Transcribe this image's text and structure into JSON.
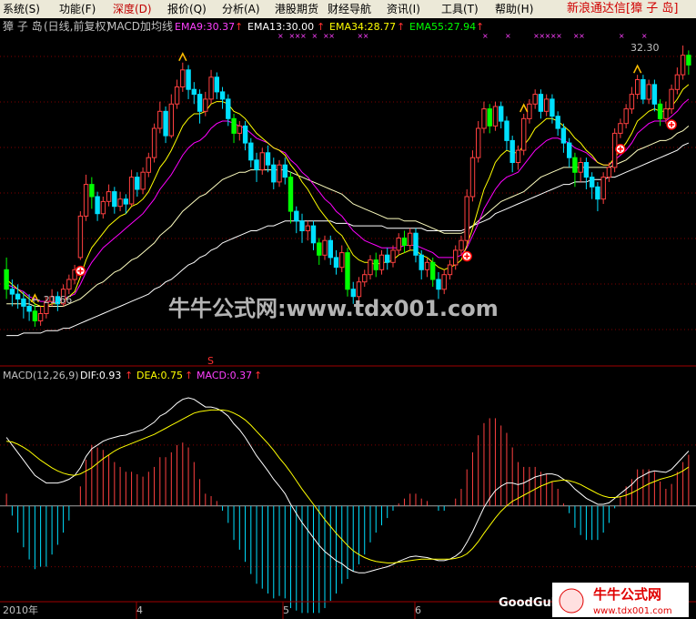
{
  "menu": {
    "items": [
      "系统(S)",
      "功能(F)",
      "深度(D)",
      "报价(Q)",
      "分析(A)",
      "港股期货",
      "财经导航",
      "资讯(I)",
      "工具(T)",
      "帮助(H)"
    ],
    "brand": "新浪通达信[獐 子 岛]",
    "window_buttons": [
      "_",
      "□",
      "×"
    ]
  },
  "colors": {
    "up": "#ff4040",
    "down": "#00e0ff",
    "down_green": "#00ff00",
    "ema9": "#ffffff",
    "ema13": "#ffff00",
    "ema34": "#ff00ff",
    "ema55": "#00ff00",
    "dif": "#ffffff",
    "dea": "#ffff00",
    "grid": "#800000"
  },
  "main_panel": {
    "stock": "獐 子 岛",
    "period": "(日线,前复权)",
    "indicator": "MACD加均线",
    "legend": [
      {
        "text": "EMA9:30.37",
        "color": "#ff40ff"
      },
      {
        "text": "EMA13:30.00",
        "color": "#ffffff"
      },
      {
        "text": "EMA34:28.77",
        "color": "#ffff00"
      },
      {
        "text": "EMA55:27.94",
        "color": "#00ff00"
      }
    ],
    "low_label": "← 21.66",
    "high_label": "32.30",
    "watermark": "牛牛公式网:www.tdx001.com"
  },
  "macd_panel": {
    "title": "MACD(12,26,9)",
    "dif": "DIF:0.93",
    "dea": "DEA:0.75",
    "macd": "MACD:0.37",
    "marker": "S"
  },
  "time_axis": {
    "labels": [
      "2010年",
      "4",
      "5",
      "6"
    ]
  },
  "logo": {
    "left_text": "GoodGul",
    "brand": "牛牛公式网",
    "url": "www.tdx001.com"
  },
  "chart_data": {
    "type": "candlestick",
    "price_range": [
      20.5,
      33.5
    ],
    "candles": [
      [
        24.0,
        23.2,
        24.5,
        22.8
      ],
      [
        23.2,
        23.0,
        23.6,
        22.5
      ],
      [
        23.0,
        22.8,
        23.4,
        22.4
      ],
      [
        22.8,
        22.5,
        23.1,
        22.0
      ],
      [
        22.5,
        22.3,
        23.0,
        21.9
      ],
      [
        22.3,
        21.9,
        22.6,
        21.66
      ],
      [
        21.9,
        22.2,
        22.5,
        21.7
      ],
      [
        22.2,
        22.7,
        22.9,
        22.0
      ],
      [
        22.7,
        22.9,
        23.2,
        22.5
      ],
      [
        22.9,
        22.6,
        23.1,
        22.3
      ],
      [
        22.6,
        23.2,
        23.4,
        22.5
      ],
      [
        23.2,
        23.6,
        23.8,
        23.0
      ],
      [
        23.6,
        24.0,
        24.2,
        23.4
      ],
      [
        24.5,
        26.2,
        26.4,
        24.4
      ],
      [
        26.2,
        27.5,
        27.9,
        26.0
      ],
      [
        27.5,
        27.0,
        27.8,
        26.5
      ],
      [
        27.0,
        26.3,
        27.2,
        26.0
      ],
      [
        26.3,
        26.8,
        27.0,
        26.1
      ],
      [
        26.8,
        27.2,
        27.5,
        26.6
      ],
      [
        27.2,
        26.6,
        27.4,
        26.3
      ],
      [
        26.6,
        26.9,
        27.2,
        26.4
      ],
      [
        26.9,
        26.7,
        27.1,
        26.3
      ],
      [
        26.7,
        27.8,
        28.1,
        26.6
      ],
      [
        27.8,
        27.3,
        28.0,
        27.0
      ],
      [
        27.3,
        28.0,
        28.2,
        27.1
      ],
      [
        28.0,
        28.6,
        28.8,
        27.8
      ],
      [
        28.6,
        29.8,
        30.0,
        28.4
      ],
      [
        29.8,
        30.5,
        30.9,
        29.6
      ],
      [
        30.5,
        29.5,
        30.7,
        29.2
      ],
      [
        29.5,
        30.8,
        31.2,
        29.4
      ],
      [
        30.8,
        31.5,
        31.8,
        30.6
      ],
      [
        31.5,
        32.2,
        32.5,
        31.3
      ],
      [
        32.2,
        31.4,
        32.4,
        31.0
      ],
      [
        31.4,
        31.2,
        31.7,
        30.8
      ],
      [
        31.2,
        30.5,
        31.4,
        30.0
      ],
      [
        30.5,
        31.0,
        31.3,
        30.3
      ],
      [
        31.0,
        31.9,
        32.2,
        30.8
      ],
      [
        31.9,
        31.3,
        32.1,
        31.0
      ],
      [
        31.3,
        31.0,
        31.5,
        30.6
      ],
      [
        31.0,
        30.2,
        31.2,
        29.9
      ],
      [
        30.2,
        29.6,
        30.4,
        29.2
      ],
      [
        29.6,
        29.9,
        30.1,
        29.3
      ],
      [
        29.9,
        29.2,
        30.1,
        28.9
      ],
      [
        29.2,
        28.5,
        29.4,
        28.2
      ],
      [
        28.5,
        28.1,
        28.8,
        27.6
      ],
      [
        28.1,
        28.8,
        29.0,
        27.9
      ],
      [
        28.8,
        28.3,
        29.1,
        28.0
      ],
      [
        28.3,
        27.6,
        28.6,
        27.3
      ],
      [
        27.6,
        28.3,
        28.5,
        27.4
      ],
      [
        28.3,
        27.8,
        28.6,
        27.5
      ],
      [
        27.8,
        26.4,
        28.0,
        25.9
      ],
      [
        26.4,
        26.0,
        26.6,
        25.5
      ],
      [
        26.0,
        25.6,
        26.3,
        25.1
      ],
      [
        25.6,
        25.8,
        26.0,
        25.2
      ],
      [
        25.8,
        25.1,
        26.0,
        24.8
      ],
      [
        25.1,
        24.6,
        25.3,
        24.2
      ],
      [
        24.6,
        25.2,
        25.4,
        24.4
      ],
      [
        25.2,
        24.5,
        25.4,
        24.2
      ],
      [
        24.5,
        24.1,
        24.8,
        23.8
      ],
      [
        24.1,
        24.7,
        25.0,
        23.9
      ],
      [
        24.7,
        23.2,
        24.9,
        22.9
      ],
      [
        23.2,
        22.9,
        23.5,
        22.6
      ],
      [
        22.9,
        23.5,
        23.7,
        22.7
      ],
      [
        23.5,
        23.8,
        24.0,
        23.3
      ],
      [
        23.8,
        24.4,
        24.6,
        23.6
      ],
      [
        24.4,
        24.0,
        24.7,
        23.7
      ],
      [
        24.0,
        24.6,
        24.8,
        23.8
      ],
      [
        24.6,
        24.3,
        24.9,
        24.0
      ],
      [
        24.3,
        24.8,
        25.0,
        24.1
      ],
      [
        24.8,
        25.3,
        25.5,
        24.6
      ],
      [
        25.3,
        25.0,
        25.6,
        24.7
      ],
      [
        25.0,
        25.5,
        25.7,
        24.8
      ],
      [
        25.5,
        24.6,
        25.7,
        24.3
      ],
      [
        24.6,
        24.0,
        24.8,
        23.6
      ],
      [
        24.0,
        24.3,
        24.5,
        23.7
      ],
      [
        24.3,
        23.6,
        24.5,
        23.3
      ],
      [
        23.6,
        23.2,
        23.9,
        22.8
      ],
      [
        23.2,
        23.8,
        24.0,
        23.0
      ],
      [
        23.8,
        24.2,
        24.4,
        23.6
      ],
      [
        24.2,
        24.8,
        25.0,
        24.0
      ],
      [
        24.8,
        25.2,
        25.4,
        24.6
      ],
      [
        25.2,
        27.0,
        27.3,
        25.0
      ],
      [
        27.0,
        28.6,
        28.9,
        26.8
      ],
      [
        28.6,
        29.8,
        30.1,
        28.4
      ],
      [
        29.8,
        30.6,
        30.9,
        29.6
      ],
      [
        30.6,
        29.9,
        30.8,
        29.6
      ],
      [
        29.9,
        30.7,
        30.9,
        29.7
      ],
      [
        30.7,
        30.1,
        30.9,
        29.8
      ],
      [
        30.1,
        29.3,
        30.3,
        28.9
      ],
      [
        29.3,
        28.4,
        29.5,
        28.0
      ],
      [
        28.4,
        28.9,
        29.1,
        28.1
      ],
      [
        28.9,
        30.2,
        30.4,
        28.7
      ],
      [
        30.2,
        30.8,
        31.0,
        30.0
      ],
      [
        30.8,
        31.2,
        31.4,
        30.6
      ],
      [
        31.2,
        30.5,
        31.4,
        30.2
      ],
      [
        30.5,
        31.0,
        31.2,
        30.3
      ],
      [
        31.0,
        30.3,
        31.2,
        30.0
      ],
      [
        30.3,
        29.8,
        30.5,
        29.5
      ],
      [
        29.8,
        29.2,
        30.0,
        28.8
      ],
      [
        29.2,
        28.6,
        29.4,
        28.2
      ],
      [
        28.6,
        28.0,
        28.8,
        27.4
      ],
      [
        28.0,
        28.4,
        28.6,
        27.6
      ],
      [
        28.4,
        27.8,
        28.6,
        27.3
      ],
      [
        27.8,
        27.4,
        28.0,
        26.9
      ],
      [
        27.4,
        26.9,
        27.6,
        26.4
      ],
      [
        26.9,
        27.8,
        28.0,
        26.7
      ],
      [
        27.8,
        28.2,
        28.4,
        27.6
      ],
      [
        28.2,
        29.6,
        29.8,
        28.0
      ],
      [
        29.6,
        30.0,
        30.2,
        29.4
      ],
      [
        30.0,
        30.6,
        30.8,
        29.8
      ],
      [
        30.6,
        31.2,
        31.5,
        30.4
      ],
      [
        31.2,
        31.8,
        32.0,
        31.0
      ],
      [
        31.8,
        31.0,
        32.0,
        30.8
      ],
      [
        31.0,
        31.6,
        31.8,
        30.8
      ],
      [
        31.6,
        30.8,
        31.8,
        30.5
      ],
      [
        30.8,
        30.2,
        31.0,
        29.9
      ],
      [
        30.2,
        30.6,
        30.9,
        30.0
      ],
      [
        30.6,
        31.4,
        31.6,
        30.4
      ],
      [
        31.4,
        32.0,
        32.3,
        31.2
      ],
      [
        32.0,
        32.8,
        33.2,
        31.8
      ],
      [
        32.8,
        32.4,
        33.0,
        32.0
      ]
    ],
    "ema9": [
      23.6,
      23.4,
      23.2,
      23.0,
      22.8,
      22.6,
      22.5,
      22.5,
      22.6,
      22.6,
      22.7,
      22.9,
      23.1,
      23.7,
      24.4,
      24.9,
      25.2,
      25.5,
      25.8,
      26.0,
      26.2,
      26.3,
      26.6,
      26.7,
      26.9,
      27.2,
      27.7,
      28.2,
      28.5,
      28.9,
      29.4,
      29.9,
      30.2,
      30.4,
      30.4,
      30.5,
      30.8,
      30.9,
      30.9,
      30.8,
      30.5,
      30.4,
      30.2,
      29.9,
      29.6,
      29.4,
      29.2,
      29.0,
      28.9,
      28.7,
      28.3,
      28.0,
      27.6,
      27.3,
      26.9,
      26.5,
      26.2,
      25.9,
      25.6,
      25.4,
      25.0,
      24.6,
      24.4,
      24.3,
      24.3,
      24.2,
      24.3,
      24.3,
      24.4,
      24.6,
      24.7,
      24.8,
      24.8,
      24.6,
      24.5,
      24.3,
      24.1,
      24.0,
      24.1,
      24.2,
      24.4,
      25.0,
      25.7,
      26.5,
      27.3,
      27.8,
      28.4,
      28.7,
      28.9,
      28.8,
      28.8,
      29.1,
      29.4,
      29.8,
      30.0,
      30.2,
      30.2,
      30.1,
      29.9,
      29.7,
      29.4,
      29.2,
      28.9,
      28.7,
      28.4,
      28.3,
      28.3,
      28.6,
      28.9,
      29.2,
      29.6,
      30.1,
      30.3,
      30.5,
      30.6,
      30.5,
      30.5,
      30.7,
      31.0,
      31.4,
      31.6
    ],
    "ema13": [
      23.4,
      23.3,
      23.2,
      23.1,
      22.9,
      22.8,
      22.7,
      22.7,
      22.7,
      22.7,
      22.8,
      22.9,
      23.0,
      23.4,
      23.9,
      24.3,
      24.6,
      24.9,
      25.1,
      25.3,
      25.5,
      25.7,
      25.9,
      26.1,
      26.3,
      26.6,
      26.9,
      27.3,
      27.6,
      27.9,
      28.3,
      28.7,
      29.0,
      29.2,
      29.3,
      29.5,
      29.8,
      30.0,
      30.1,
      30.1,
      30.0,
      29.9,
      29.8,
      29.6,
      29.4,
      29.3,
      29.2,
      29.0,
      28.9,
      28.8,
      28.5,
      28.3,
      28.0,
      27.8,
      27.5,
      27.2,
      26.9,
      26.7,
      26.4,
      26.2,
      25.9,
      25.6,
      25.4,
      25.2,
      25.1,
      25.0,
      24.9,
      24.9,
      24.9,
      24.9,
      25.0,
      25.0,
      25.0,
      24.9,
      24.8,
      24.7,
      24.5,
      24.5,
      24.5,
      24.5,
      24.6,
      24.9,
      25.4,
      25.9,
      26.5,
      26.9,
      27.3,
      27.6,
      27.8,
      27.9,
      28.0,
      28.3,
      28.6,
      28.9,
      29.1,
      29.3,
      29.4,
      29.4,
      29.3,
      29.2,
      29.0,
      28.9,
      28.8,
      28.6,
      28.4,
      28.3,
      28.3,
      28.5,
      28.7,
      28.9,
      29.2,
      29.6,
      29.8,
      30.0,
      30.1,
      30.1,
      30.1,
      30.3,
      30.5,
      30.8,
      31.0
    ],
    "ema34": [
      22.6,
      22.6,
      22.6,
      22.6,
      22.6,
      22.5,
      22.5,
      22.5,
      22.5,
      22.5,
      22.5,
      22.6,
      22.7,
      22.8,
      23.0,
      23.2,
      23.4,
      23.5,
      23.7,
      23.9,
      24.0,
      24.2,
      24.4,
      24.5,
      24.7,
      24.9,
      25.1,
      25.4,
      25.6,
      25.8,
      26.1,
      26.4,
      26.6,
      26.8,
      27.0,
      27.1,
      27.3,
      27.5,
      27.7,
      27.8,
      27.9,
      28.0,
      28.0,
      28.1,
      28.1,
      28.1,
      28.1,
      28.1,
      28.1,
      28.1,
      28.0,
      27.9,
      27.8,
      27.7,
      27.6,
      27.5,
      27.4,
      27.3,
      27.2,
      27.1,
      26.9,
      26.7,
      26.6,
      26.5,
      26.4,
      26.3,
      26.2,
      26.1,
      26.1,
      26.1,
      26.0,
      26.0,
      26.0,
      25.9,
      25.8,
      25.7,
      25.6,
      25.5,
      25.5,
      25.5,
      25.5,
      25.6,
      25.8,
      26.0,
      26.2,
      26.4,
      26.6,
      26.8,
      26.9,
      27.0,
      27.1,
      27.2,
      27.4,
      27.6,
      27.8,
      27.9,
      28.0,
      28.1,
      28.2,
      28.2,
      28.2,
      28.2,
      28.2,
      28.2,
      28.2,
      28.2,
      28.2,
      28.3,
      28.4,
      28.5,
      28.7,
      28.9,
      29.0,
      29.1,
      29.2,
      29.3,
      29.3,
      29.4,
      29.6,
      29.7,
      29.9
    ],
    "ema55": [
      21.3,
      21.3,
      21.3,
      21.4,
      21.4,
      21.4,
      21.4,
      21.5,
      21.5,
      21.5,
      21.6,
      21.6,
      21.7,
      21.8,
      21.9,
      22.0,
      22.1,
      22.2,
      22.3,
      22.4,
      22.5,
      22.6,
      22.7,
      22.8,
      22.9,
      23.0,
      23.2,
      23.3,
      23.5,
      23.6,
      23.8,
      24.0,
      24.2,
      24.3,
      24.5,
      24.6,
      24.8,
      24.9,
      25.1,
      25.2,
      25.3,
      25.4,
      25.5,
      25.6,
      25.6,
      25.7,
      25.8,
      25.8,
      25.9,
      26.0,
      26.0,
      26.0,
      26.0,
      26.0,
      26.0,
      26.0,
      26.0,
      26.0,
      25.9,
      25.9,
      25.9,
      25.8,
      25.8,
      25.8,
      25.8,
      25.8,
      25.8,
      25.7,
      25.7,
      25.7,
      25.7,
      25.7,
      25.7,
      25.7,
      25.6,
      25.6,
      25.6,
      25.6,
      25.6,
      25.6,
      25.6,
      25.7,
      25.8,
      25.9,
      26.0,
      26.1,
      26.3,
      26.4,
      26.5,
      26.6,
      26.7,
      26.8,
      26.9,
      27.0,
      27.1,
      27.2,
      27.3,
      27.4,
      27.5,
      27.5,
      27.6,
      27.6,
      27.6,
      27.7,
      27.7,
      27.7,
      27.8,
      27.8,
      27.9,
      28.0,
      28.1,
      28.2,
      28.3,
      28.4,
      28.5,
      28.6,
      28.7,
      28.8,
      28.9,
      29.1,
      29.2
    ],
    "macd_range": [
      -1.2,
      1.6
    ],
    "dif": [
      0.9,
      0.8,
      0.7,
      0.6,
      0.5,
      0.4,
      0.35,
      0.3,
      0.3,
      0.3,
      0.32,
      0.35,
      0.4,
      0.5,
      0.65,
      0.75,
      0.8,
      0.85,
      0.88,
      0.9,
      0.92,
      0.93,
      0.96,
      0.98,
      1.0,
      1.05,
      1.1,
      1.18,
      1.22,
      1.28,
      1.35,
      1.4,
      1.42,
      1.4,
      1.35,
      1.3,
      1.3,
      1.28,
      1.24,
      1.18,
      1.08,
      1.0,
      0.9,
      0.78,
      0.66,
      0.56,
      0.46,
      0.35,
      0.26,
      0.16,
      0.02,
      -0.1,
      -0.22,
      -0.32,
      -0.42,
      -0.52,
      -0.6,
      -0.66,
      -0.72,
      -0.76,
      -0.82,
      -0.86,
      -0.88,
      -0.88,
      -0.86,
      -0.84,
      -0.82,
      -0.8,
      -0.77,
      -0.73,
      -0.7,
      -0.67,
      -0.66,
      -0.67,
      -0.68,
      -0.7,
      -0.72,
      -0.72,
      -0.7,
      -0.66,
      -0.6,
      -0.48,
      -0.34,
      -0.18,
      -0.02,
      0.1,
      0.2,
      0.26,
      0.3,
      0.3,
      0.28,
      0.3,
      0.34,
      0.38,
      0.4,
      0.42,
      0.42,
      0.4,
      0.35,
      0.3,
      0.22,
      0.16,
      0.1,
      0.06,
      0.02,
      0.02,
      0.04,
      0.1,
      0.16,
      0.22,
      0.28,
      0.36,
      0.4,
      0.44,
      0.46,
      0.45,
      0.44,
      0.48,
      0.56,
      0.64,
      0.72
    ],
    "dea": [
      0.85,
      0.84,
      0.81,
      0.77,
      0.72,
      0.66,
      0.6,
      0.55,
      0.5,
      0.46,
      0.43,
      0.41,
      0.4,
      0.42,
      0.46,
      0.5,
      0.56,
      0.62,
      0.67,
      0.72,
      0.76,
      0.79,
      0.82,
      0.85,
      0.88,
      0.91,
      0.94,
      0.98,
      1.02,
      1.06,
      1.1,
      1.14,
      1.18,
      1.22,
      1.24,
      1.25,
      1.26,
      1.26,
      1.26,
      1.25,
      1.22,
      1.18,
      1.13,
      1.06,
      0.98,
      0.9,
      0.82,
      0.73,
      0.63,
      0.54,
      0.44,
      0.33,
      0.22,
      0.12,
      0.02,
      -0.08,
      -0.18,
      -0.27,
      -0.36,
      -0.44,
      -0.52,
      -0.59,
      -0.64,
      -0.68,
      -0.71,
      -0.73,
      -0.74,
      -0.75,
      -0.75,
      -0.74,
      -0.73,
      -0.72,
      -0.71,
      -0.7,
      -0.7,
      -0.7,
      -0.7,
      -0.7,
      -0.7,
      -0.69,
      -0.67,
      -0.63,
      -0.56,
      -0.47,
      -0.36,
      -0.26,
      -0.16,
      -0.07,
      0.0,
      0.06,
      0.1,
      0.14,
      0.18,
      0.22,
      0.26,
      0.29,
      0.32,
      0.33,
      0.34,
      0.33,
      0.31,
      0.28,
      0.24,
      0.2,
      0.16,
      0.13,
      0.11,
      0.11,
      0.12,
      0.14,
      0.17,
      0.21,
      0.25,
      0.29,
      0.32,
      0.35,
      0.37,
      0.39,
      0.42,
      0.46,
      0.51
    ]
  }
}
